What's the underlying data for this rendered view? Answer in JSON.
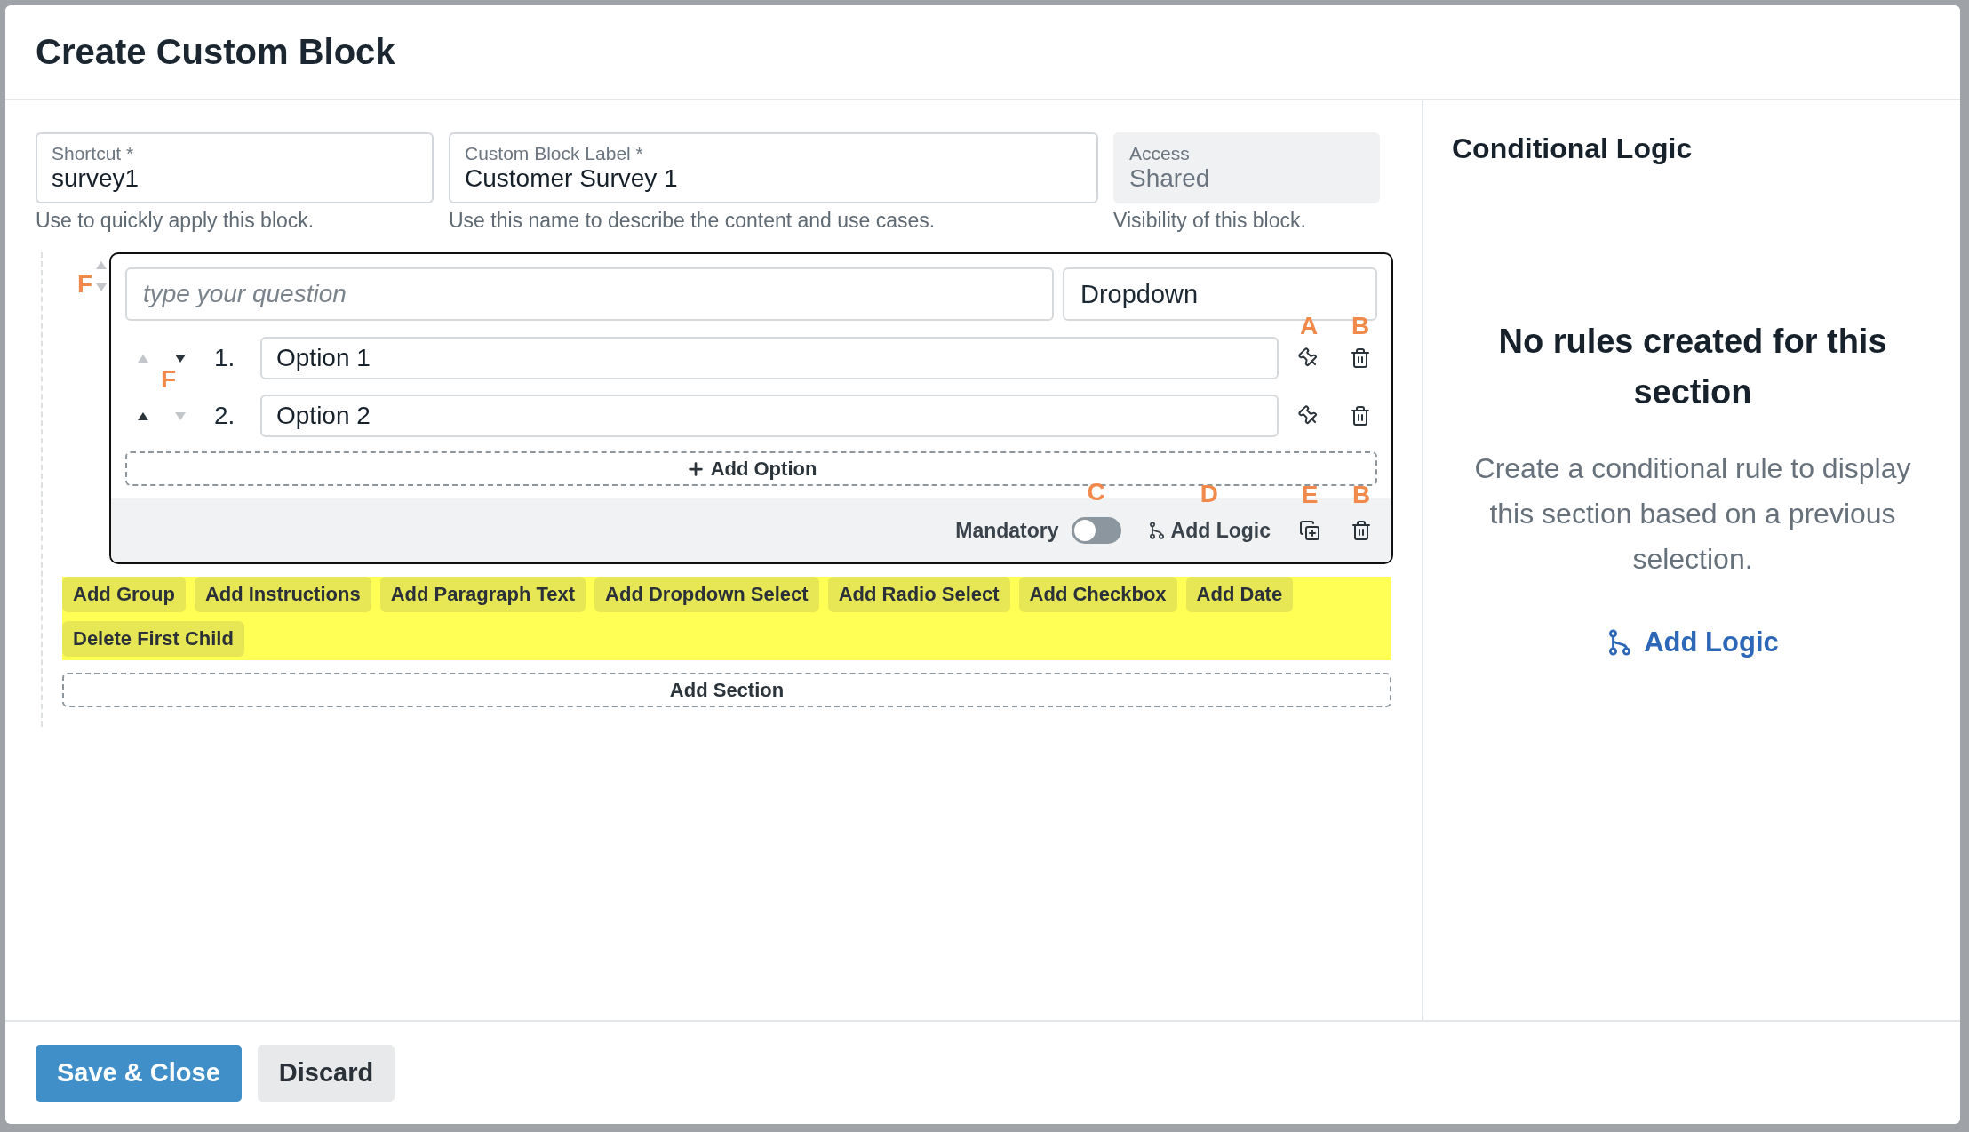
{
  "dialog": {
    "title": "Create Custom Block"
  },
  "fields": [
    {
      "label": "Shortcut *",
      "value": "survey1",
      "help": "Use to quickly apply this block.",
      "disabled": false
    },
    {
      "label": "Custom Block Label *",
      "value": "Customer Survey 1",
      "help": "Use this name to describe the content and use cases.",
      "disabled": false
    },
    {
      "label": "Access",
      "value": "Shared",
      "help": "Visibility of this block.",
      "disabled": true
    }
  ],
  "question_block": {
    "annotation": "F",
    "up_enabled": false,
    "down_enabled": false,
    "question_placeholder": "type your question",
    "type": "Dropdown",
    "options_annotation": "F",
    "options": [
      {
        "number": "1.",
        "value": "Option 1",
        "up_enabled": false,
        "down_enabled": true,
        "pin_annotation": "A",
        "delete_annotation": "B"
      },
      {
        "number": "2.",
        "value": "Option 2",
        "up_enabled": true,
        "down_enabled": false
      }
    ],
    "add_option": "Add Option",
    "footer": {
      "mandatory_label": "Mandatory",
      "mandatory_on": false,
      "toggle_annotation": "C",
      "add_logic": "Add Logic",
      "add_logic_annotation": "D",
      "duplicate_annotation": "E",
      "delete_annotation": "B"
    }
  },
  "debug_actions": [
    "Add Group",
    "Add Instructions",
    "Add Paragraph Text",
    "Add Dropdown Select",
    "Add Radio Select",
    "Add Checkbox",
    "Add Date",
    "Delete First Child"
  ],
  "add_section": "Add Section",
  "conditional_logic": {
    "title": "Conditional Logic",
    "empty_title": "No rules created for this section",
    "empty_text": "Create a conditional rule to display this section based on a previous selection.",
    "add_logic": "Add Logic"
  },
  "buttons": [
    {
      "label": "Save & Close",
      "kind": "primary"
    },
    {
      "label": "Discard",
      "kind": "secondary"
    }
  ]
}
